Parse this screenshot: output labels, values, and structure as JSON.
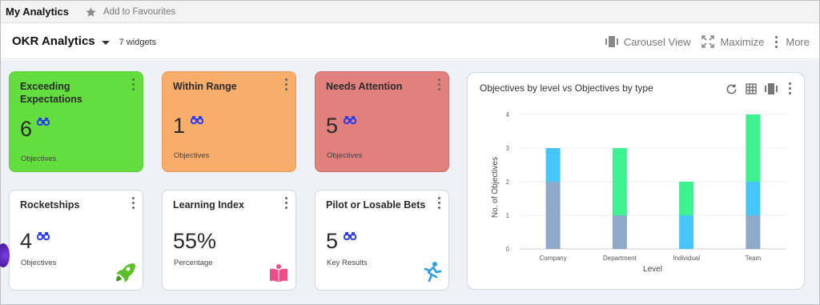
{
  "topbar": {
    "title": "My Analytics",
    "favourite_label": "Add to Favourites"
  },
  "header": {
    "dashboard_title": "OKR Analytics",
    "widget_count": "7 widgets",
    "actions": {
      "carousel": "Carousel View",
      "maximize": "Maximize",
      "more": "More"
    }
  },
  "widgets": [
    {
      "title": "Exceeding Expectations",
      "value": "6",
      "subtitle": "Objectives",
      "color": "#64dd3f"
    },
    {
      "title": "Within Range",
      "value": "1",
      "subtitle": "Objectives",
      "color": "#f9ad6b"
    },
    {
      "title": "Needs Attention",
      "value": "5",
      "subtitle": "Objectives",
      "color": "#e2807e"
    },
    {
      "title": "Rocketships",
      "value": "4",
      "subtitle": "Objectives",
      "icon": "rocket-icon"
    },
    {
      "title": "Learning Index",
      "value": "55%",
      "subtitle": "Percentage",
      "icon": "book-icon"
    },
    {
      "title": "Pilot or Losable Bets",
      "value": "5",
      "subtitle": "Key Results",
      "icon": "falling-person-icon"
    }
  ],
  "chart_card": {
    "title": "Objectives by level vs Objectives by type"
  },
  "chart_data": {
    "type": "bar",
    "stacked": true,
    "categories": [
      "Company",
      "Department",
      "Individual",
      "Team"
    ],
    "series": [
      {
        "color": "#8fa9c9",
        "values": [
          2,
          1,
          0,
          1
        ]
      },
      {
        "color": "#45c6f7",
        "values": [
          1,
          0,
          1,
          1
        ]
      },
      {
        "color": "#3ef191",
        "values": [
          0,
          2,
          1,
          2
        ]
      }
    ],
    "xlabel": "Level",
    "ylabel": "No. of Objectives",
    "ylim": [
      0,
      4
    ],
    "yticks": [
      0,
      1,
      2,
      3,
      4
    ],
    "grid": true
  }
}
